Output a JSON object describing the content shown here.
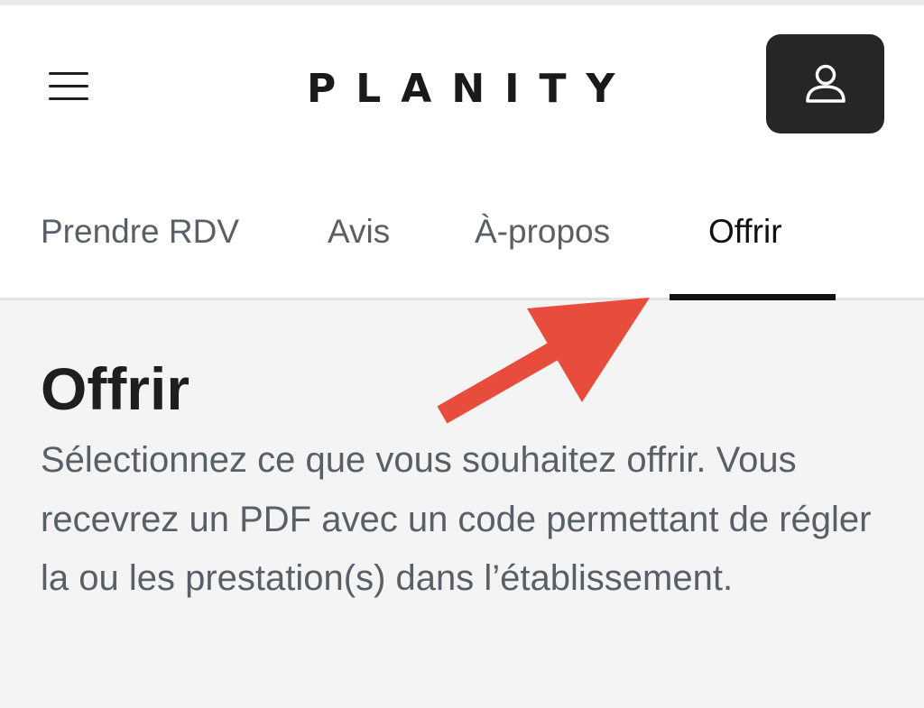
{
  "header": {
    "logo": "PLANITY"
  },
  "tabs": [
    {
      "label": "Prendre RDV"
    },
    {
      "label": "Avis"
    },
    {
      "label": "À-propos"
    },
    {
      "label": "Offrir",
      "active": true
    }
  ],
  "content": {
    "title": "Offrir",
    "description": "Sélectionnez ce que vous souhaitez offrir. Vous recevrez un PDF avec un code permettant de régler la ou les prestation(s) dans l’établissement."
  },
  "colors": {
    "accent_dark": "#262626",
    "annotation_arrow": "#e84c3d",
    "content_background": "#f4f4f4"
  },
  "icons": {
    "menu": "hamburger-menu-icon",
    "account": "user-icon",
    "annotation": "red-arrow"
  }
}
